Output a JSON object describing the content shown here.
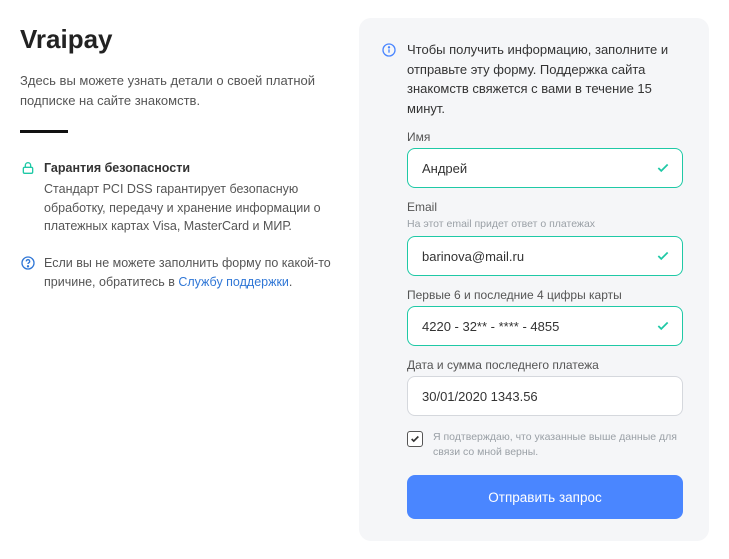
{
  "left": {
    "title": "Vraipay",
    "subtitle": "Здесь вы можете узнать детали о своей платной подписке на сайте знакомств.",
    "security_heading": "Гарантия безопасности",
    "security_text": "Стандарт PCI DSS гарантирует безопасную обработку, передачу и хранение информации о платежных картах Visa, MasterCard и МИР.",
    "help_text_prefix": "Если вы не можете заполнить форму по какой-то причине, обратитесь в ",
    "help_link": "Службу поддержки",
    "help_text_suffix": "."
  },
  "form": {
    "notice": "Чтобы получить информацию, заполните и отправьте эту форму. Поддержка сайта знакомств свяжется с вами в течение 15 минут.",
    "name_label": "Имя",
    "name_value": "Андрей",
    "email_label": "Email",
    "email_hint": "На этот email придет ответ о платежах",
    "email_value": "barinova@mail.ru",
    "card_label": "Первые 6 и последние 4 цифры карты",
    "card_value": "4220 - 32** - **** - 4855",
    "payment_label": "Дата и сумма последнего платежа",
    "payment_value": "30/01/2020 1343.56",
    "consent_text": "Я подтверждаю, что указанные выше данные для связи со мной верны.",
    "submit_label": "Отправить запрос"
  }
}
